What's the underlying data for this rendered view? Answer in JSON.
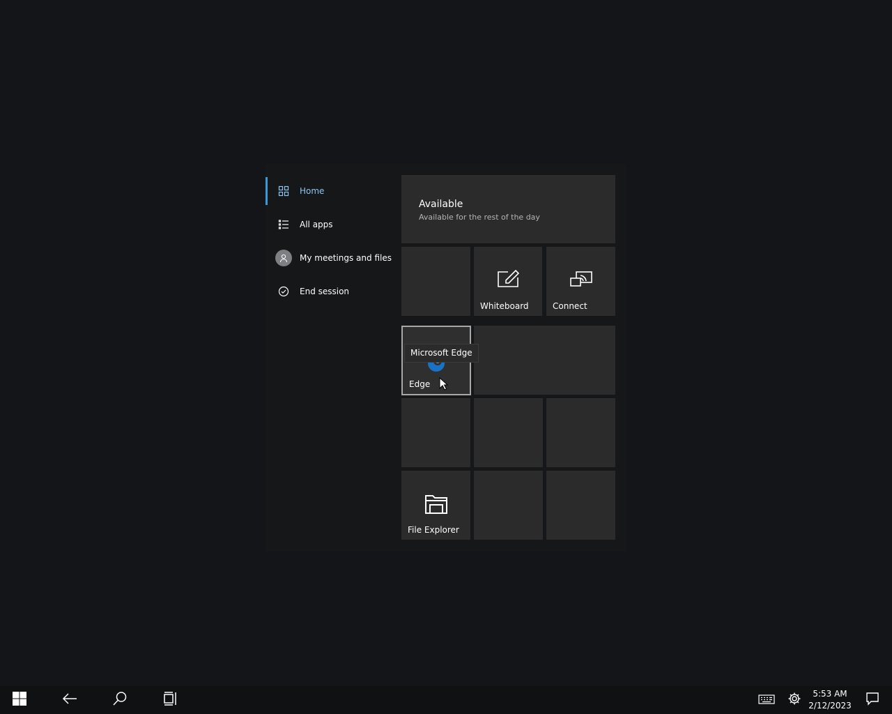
{
  "nav": {
    "items": [
      {
        "label": "Home",
        "icon": "home-grid-icon",
        "active": true
      },
      {
        "label": "All apps",
        "icon": "list-icon"
      },
      {
        "label": "My meetings and files",
        "icon": "person-avatar-icon"
      },
      {
        "label": "End session",
        "icon": "check-circle-icon"
      }
    ]
  },
  "status": {
    "title": "Available",
    "subtitle": "Available for the rest of the day"
  },
  "tiles": {
    "whiteboard": "Whiteboard",
    "connect": "Connect",
    "edge": "Edge",
    "file_explorer": "File Explorer"
  },
  "tooltip": {
    "text": "Microsoft Edge"
  },
  "taskbar": {
    "time": "5:53 AM",
    "date": "2/12/2023"
  },
  "colors": {
    "accent": "#3a9ad9",
    "tile": "#2b2b2c",
    "background": "#131519"
  }
}
